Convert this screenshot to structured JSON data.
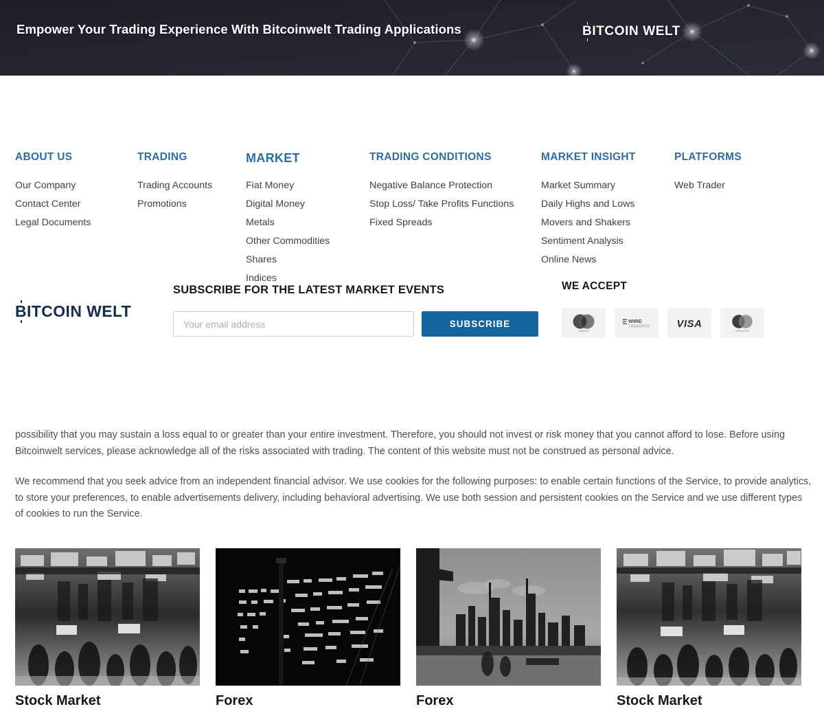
{
  "banner": {
    "headline": "Empower Your Trading Experience With Bitcoinwelt Trading Applications",
    "logo_prefix": "B",
    "logo_text": "ITCOIN WELT",
    "bg_color": "#22232e"
  },
  "footer_columns": [
    {
      "heading": "ABOUT US",
      "links": [
        "Our Company",
        "Contact Center",
        "Legal Documents"
      ]
    },
    {
      "heading": "TRADING",
      "links": [
        "Trading Accounts",
        "Promotions"
      ]
    },
    {
      "heading": "MARKET",
      "links": [
        "Fiat Money",
        "Digital Money",
        "Metals",
        "Other Commodities",
        "Shares",
        "Indices"
      ]
    },
    {
      "heading": "TRADING CONDITIONS",
      "links": [
        "Negative Balance Protection",
        "Stop Loss/ Take Profits Functions",
        "Fixed Spreads"
      ]
    },
    {
      "heading": "MARKET INSIGHT",
      "links": [
        "Market Summary",
        "Daily Highs and Lows",
        "Movers and Shakers",
        "Sentiment Analysis",
        "Online News"
      ]
    },
    {
      "heading": "PLATFORMS",
      "links": [
        "Web Trader"
      ]
    }
  ],
  "subscribe": {
    "logo_prefix": "B",
    "logo_text": "ITCOIN WELT",
    "title": "SUBSCRIBE FOR THE LATEST MARKET EVENTS",
    "email_placeholder": "Your email address",
    "email_value": "",
    "button_label": "SUBSCRIBE",
    "button_color": "#15639f",
    "accept_title": "WE ACCEPT",
    "payment_methods": [
      {
        "name": "maestro-icon",
        "label": "maestro"
      },
      {
        "name": "wire-transfer-icon",
        "label": "WIRE TRANSFER"
      },
      {
        "name": "visa-icon",
        "label": "VISA"
      },
      {
        "name": "mastercard-icon",
        "label": "mastercard"
      }
    ]
  },
  "disclaimer": {
    "paragraph_1": "possibility that you may sustain a loss equal to or greater than your entire investment. Therefore, you should not invest or risk money that you cannot afford to lose. Before using Bitcoinwelt services, please acknowledge all of the risks associated with trading. The content of this website must not be construed as personal advice.",
    "paragraph_2": "We recommend that you seek advice from an independent financial advisor. We use cookies for the following purposes: to enable certain functions of the Service, to provide analytics, to store your preferences, to enable advertisements delivery, including behavioral advertising. We use both session and persistent cookies on the Service and we use different types of cookies to run the Service."
  },
  "cards": [
    {
      "caption": "Stock Market",
      "image": "trading-floor-photo"
    },
    {
      "caption": "Forex",
      "image": "stock-ticker-board-photo"
    },
    {
      "caption": "Forex",
      "image": "city-skyline-photo"
    },
    {
      "caption": "Stock Market",
      "image": "trading-floor-photo"
    }
  ],
  "colors": {
    "heading_blue": "#2f6ba3",
    "link_gray": "#3c3f46",
    "logo_navy": "#132c4a"
  }
}
